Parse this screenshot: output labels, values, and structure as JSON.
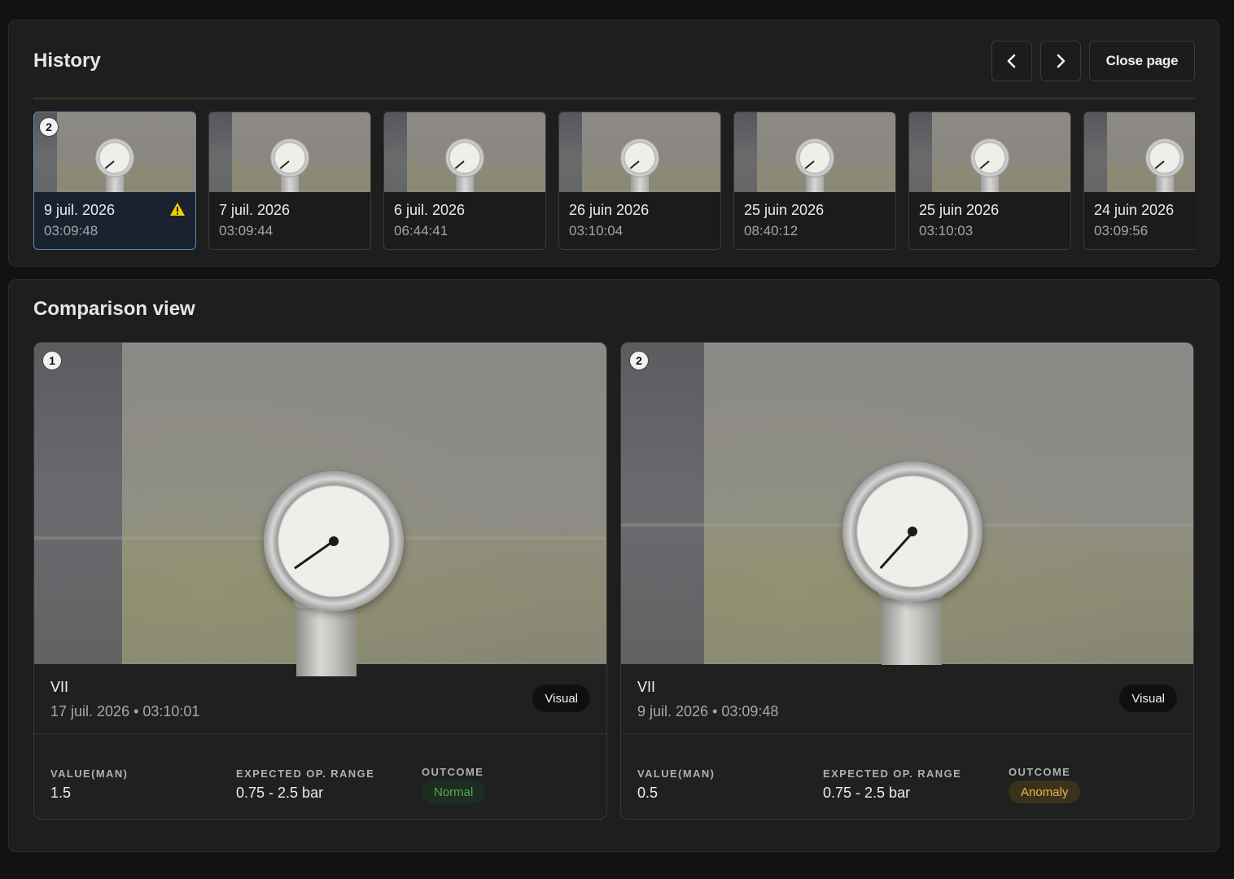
{
  "history": {
    "title": "History",
    "close_label": "Close page",
    "thumbnails": [
      {
        "badge": "2",
        "date": "9 juil. 2026",
        "time": "03:09:48",
        "selected": true,
        "warning": true
      },
      {
        "date": "7 juil. 2026",
        "time": "03:09:44"
      },
      {
        "date": "6 juil. 2026",
        "time": "06:44:41"
      },
      {
        "date": "26 juin 2026",
        "time": "03:10:04"
      },
      {
        "date": "25 juin 2026",
        "time": "08:40:12"
      },
      {
        "date": "25 juin 2026",
        "time": "03:10:03"
      },
      {
        "date": "24 juin 2026",
        "time": "03:09:56"
      }
    ]
  },
  "comparison": {
    "title": "Comparison view",
    "labels": {
      "value": "VALUE(MAN)",
      "range": "EXPECTED OP. RANGE",
      "outcome": "OUTCOME"
    },
    "cards": [
      {
        "badge": "1",
        "name": "VII",
        "datetime": "17 juil. 2026 • 03:10:01",
        "tag": "Visual",
        "value": "1.5",
        "range": "0.75 - 2.5 bar",
        "outcome": "Normal"
      },
      {
        "badge": "2",
        "name": "VII",
        "datetime": "9 juil. 2026 • 03:09:48",
        "tag": "Visual",
        "value": "0.5",
        "range": "0.75 - 2.5 bar",
        "outcome": "Anomaly"
      }
    ]
  },
  "icons": {
    "prev": "chevron-left-icon",
    "next": "chevron-right-icon",
    "warning": "warning-triangle-icon"
  },
  "colors": {
    "selected_border": "#5d86b8",
    "normal": "#55a85e",
    "anomaly": "#e3bb50",
    "warning": "#f2d000"
  }
}
